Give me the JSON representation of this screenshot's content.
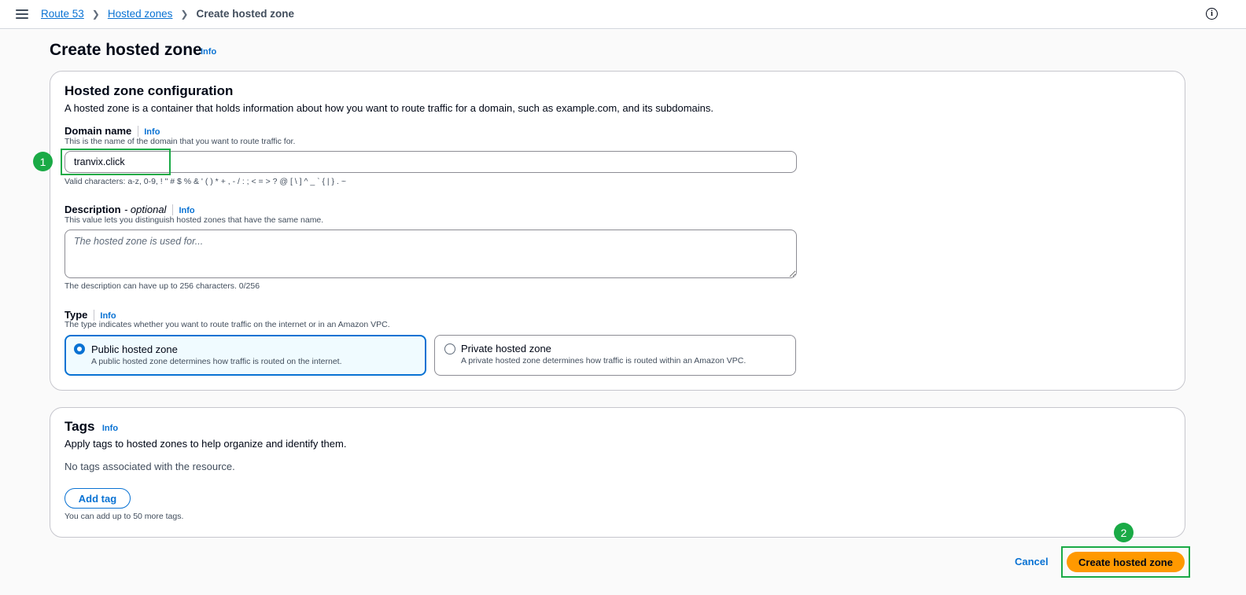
{
  "breadcrumb": {
    "items": [
      "Route 53",
      "Hosted zones"
    ],
    "current": "Create hosted zone"
  },
  "page": {
    "title": "Create hosted zone",
    "info": "Info"
  },
  "config": {
    "heading": "Hosted zone configuration",
    "description": "A hosted zone is a container that holds information about how you want to route traffic for a domain, such as example.com, and its subdomains.",
    "domain": {
      "label": "Domain name",
      "info": "Info",
      "hint": "This is the name of the domain that you want to route traffic for.",
      "value": "tranvix.click",
      "constraint": "Valid characters: a-z, 0-9, ! \" # $ % & ' ( ) * + , - / : ; < = > ? @ [ \\ ] ^ _ ` { | } . ~"
    },
    "description_field": {
      "label": "Description",
      "optional": "- optional",
      "info": "Info",
      "hint": "This value lets you distinguish hosted zones that have the same name.",
      "placeholder": "The hosted zone is used for...",
      "constraint": "The description can have up to 256 characters. 0/256"
    },
    "type": {
      "label": "Type",
      "info": "Info",
      "hint": "The type indicates whether you want to route traffic on the internet or in an Amazon VPC.",
      "options": [
        {
          "title": "Public hosted zone",
          "description": "A public hosted zone determines how traffic is routed on the internet.",
          "selected": true
        },
        {
          "title": "Private hosted zone",
          "description": "A private hosted zone determines how traffic is routed within an Amazon VPC.",
          "selected": false
        }
      ]
    }
  },
  "tags": {
    "heading": "Tags",
    "info": "Info",
    "description": "Apply tags to hosted zones to help organize and identify them.",
    "empty": "No tags associated with the resource.",
    "add_label": "Add tag",
    "limit": "You can add up to 50 more tags."
  },
  "actions": {
    "cancel": "Cancel",
    "submit": "Create hosted zone"
  },
  "annotations": {
    "marker1": "1",
    "marker2": "2"
  },
  "colors": {
    "link": "#0972d3",
    "primary": "#ff9900",
    "highlight": "#1aaa46"
  },
  "icons": [
    "menu-icon",
    "chevron-right-icon",
    "info-circle-icon",
    "radio-icon"
  ]
}
